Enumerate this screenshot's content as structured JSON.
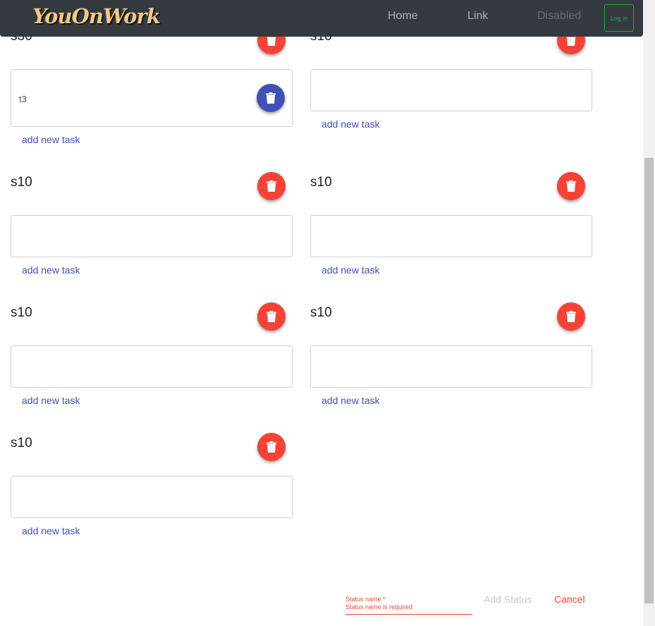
{
  "navbar": {
    "brand": "YouOnWork",
    "links": {
      "home": "Home",
      "link": "Link",
      "disabled": "Disabled"
    },
    "login_label": "Log in"
  },
  "statuses": [
    {
      "title": "s30",
      "task": "t3",
      "add_task_label": "add new task"
    },
    {
      "title": "s10",
      "task": "",
      "add_task_label": "add new task"
    },
    {
      "title": "s10",
      "task": "",
      "add_task_label": "add new task"
    },
    {
      "title": "s10",
      "task": "",
      "add_task_label": "add new task"
    },
    {
      "title": "s10",
      "task": "",
      "add_task_label": "add new task"
    },
    {
      "title": "s10",
      "task": "",
      "add_task_label": "add new task"
    },
    {
      "title": "s10",
      "task": "",
      "add_task_label": "add new task"
    }
  ],
  "new_status_form": {
    "label": "Status name *",
    "error": "Status name is required",
    "add_label": "Add Status",
    "cancel_label": "Cancel"
  },
  "colors": {
    "navbar_bg": "#343a40",
    "danger": "#f44336",
    "primary": "#3f51b5",
    "success": "#28a745"
  },
  "icons": {
    "delete": "trash-icon"
  }
}
